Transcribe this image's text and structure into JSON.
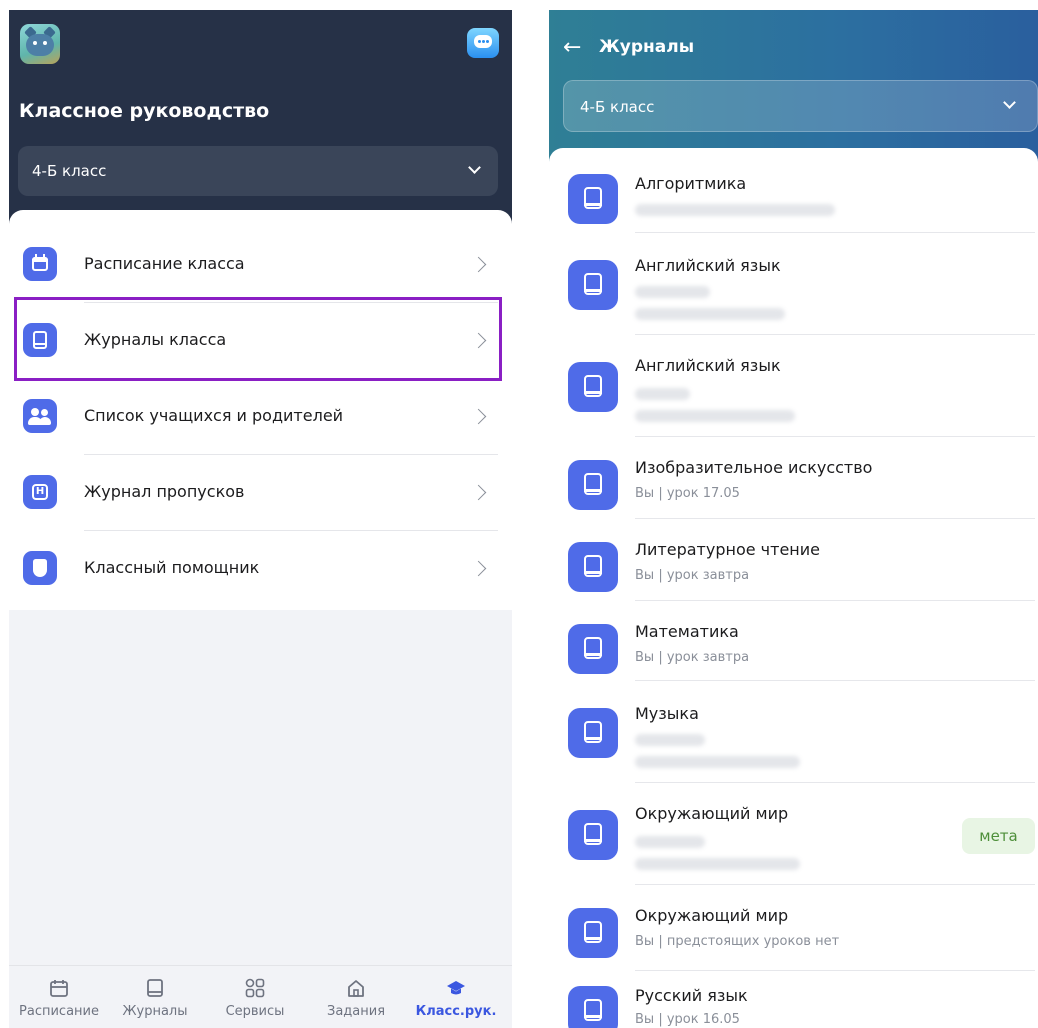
{
  "left_screen": {
    "title": "Классное руководство",
    "class_selector": {
      "value": "4-Б класс"
    },
    "menu": [
      {
        "label": "Расписание класса",
        "icon": "calendar-icon"
      },
      {
        "label": "Журналы класса",
        "icon": "book-icon"
      },
      {
        "label": "Список учащихся и родителей",
        "icon": "people-icon"
      },
      {
        "label": "Журнал пропусков",
        "icon": "absence-icon"
      },
      {
        "label": "Классный помощник",
        "icon": "shield-icon"
      }
    ],
    "tabbar": [
      {
        "label": "Расписание",
        "icon": "calendar-icon"
      },
      {
        "label": "Журналы",
        "icon": "book-icon"
      },
      {
        "label": "Сервисы",
        "icon": "services-icon"
      },
      {
        "label": "Задания",
        "icon": "home-icon"
      },
      {
        "label": "Класс.рук.",
        "icon": "graduation-cap-icon"
      }
    ]
  },
  "right_screen": {
    "title": "Журналы",
    "back_icon": "←",
    "class_selector": {
      "value": "4-Б класс"
    },
    "subjects": [
      {
        "title": "Алгоритмика",
        "subtitle": ""
      },
      {
        "title": "Английский язык",
        "subtitle": ""
      },
      {
        "title": "Английский язык",
        "subtitle": ""
      },
      {
        "title": "Изобразительное искусство",
        "subtitle": "Вы | урок 17.05"
      },
      {
        "title": "Литературное чтение",
        "subtitle": "Вы | урок завтра"
      },
      {
        "title": "Математика",
        "subtitle": "Вы | урок завтра"
      },
      {
        "title": "Музыка",
        "subtitle": ""
      },
      {
        "title": "Окружающий мир",
        "subtitle": "",
        "tag": "мета"
      },
      {
        "title": "Окружающий мир",
        "subtitle": "Вы | предстоящих уроков нет"
      },
      {
        "title": "Русский язык",
        "subtitle": "Вы | урок 16.05"
      }
    ]
  },
  "colors": {
    "left_header": "#263147",
    "accent": "#4f6be8",
    "highlight": "#8a1fc4",
    "active_tab": "#3b57e0",
    "tag_bg": "#e8f5e4",
    "tag_text": "#4e8f3a"
  }
}
